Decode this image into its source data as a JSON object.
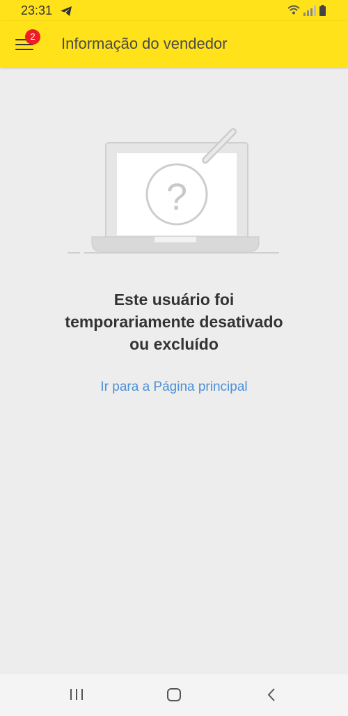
{
  "status_bar": {
    "time": "23:31"
  },
  "header": {
    "title": "Informação do vendedor",
    "notification_count": "2",
    "background_color": "#ffe21a"
  },
  "empty_state": {
    "message_lines": [
      "Este usuário foi",
      "temporariamente desativado",
      "ou excluído"
    ],
    "home_link": "Ir para a Página principal",
    "link_color": "#4a90d6",
    "illustration": "laptop-question-icon"
  },
  "nav_bar": {
    "icons": [
      "recent-apps-icon",
      "home-icon",
      "back-icon"
    ]
  }
}
